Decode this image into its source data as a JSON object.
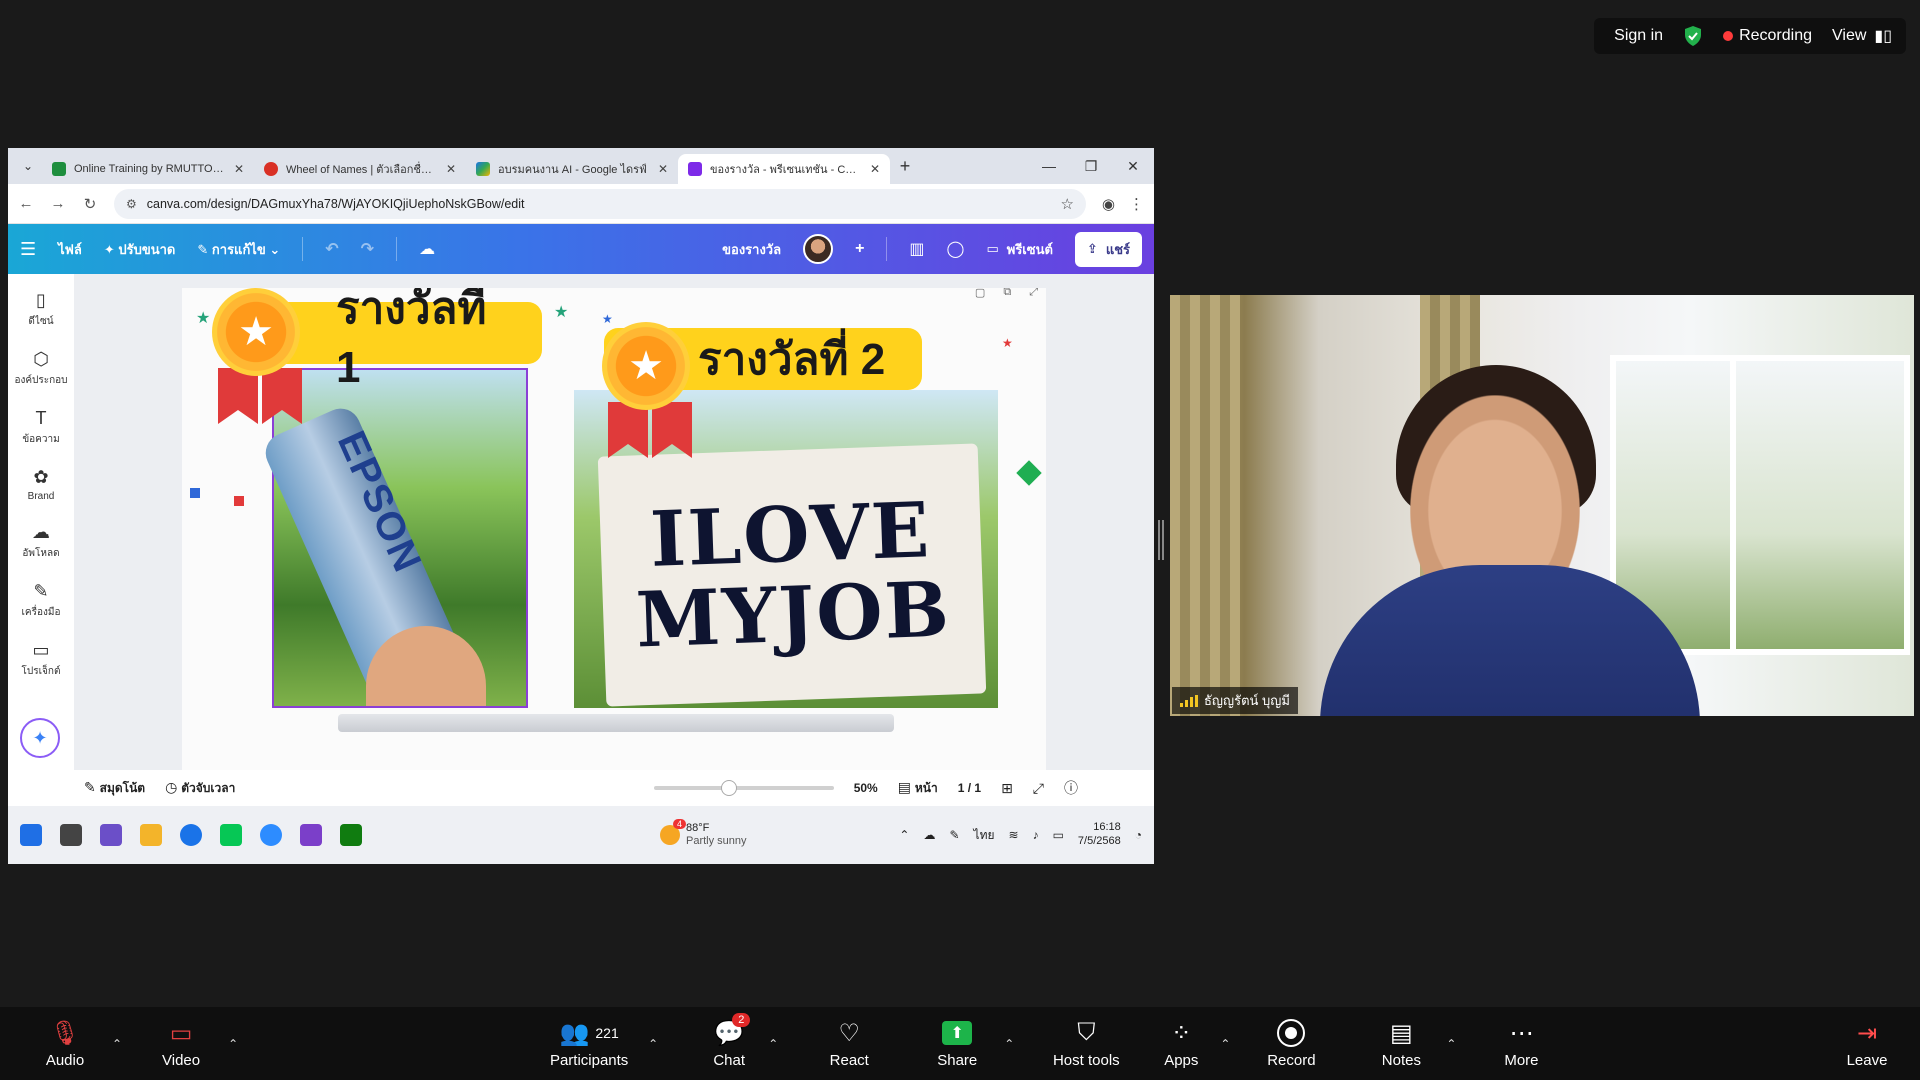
{
  "zoom_top": {
    "sign_in": "Sign in",
    "recording": "Recording",
    "view": "View"
  },
  "browser": {
    "tabs": [
      {
        "title": "Online Training by RMUTTO Lib",
        "fav_color": "#1e8e3e"
      },
      {
        "title": "Wheel of Names | ตัวเลือกชื่อแบบ",
        "fav_color": "#d93025"
      },
      {
        "title": "อบรมคนงาน AI - Google ไดรฟ์",
        "fav_color": "#f4b400"
      },
      {
        "title": "ของรางวัล - พรีเซนเทชัน - Canva",
        "fav_color": "#7d2ae8"
      }
    ],
    "url": "canva.com/design/DAGmuxYha78/WjAYOKIQjiUephoNskGBow/edit"
  },
  "canva": {
    "toolbar": {
      "file": "ไฟล์",
      "resize": "ปรับขนาด",
      "edit": "การแก้ไข",
      "doc_title": "ของรางวัล",
      "present": "พรีเซนต์",
      "share": "แชร์"
    },
    "sidebar": [
      {
        "label": "ดีไซน์",
        "icon": "▯"
      },
      {
        "label": "องค์ประกอบ",
        "icon": "⬡"
      },
      {
        "label": "ข้อความ",
        "icon": "T"
      },
      {
        "label": "Brand",
        "icon": "✿"
      },
      {
        "label": "อัพโหลด",
        "icon": "☁"
      },
      {
        "label": "เครื่องมือ",
        "icon": "✎"
      },
      {
        "label": "โปรเจ็กต์",
        "icon": "▭"
      }
    ],
    "slide": {
      "prize1": "รางวัลที่ 1",
      "prize2": "รางวัลที่ 2",
      "bottle_text": "EPSON",
      "sign_line1": "ILOVE",
      "sign_line2": "MYJOB"
    },
    "footer": {
      "notes": "สมุดโน้ต",
      "timer": "ตัวจับเวลา",
      "zoom": "50%",
      "page_label": "หน้า",
      "page_count": "1 / 1",
      "zoom_fraction": 0.42
    }
  },
  "taskbar": {
    "weather_temp": "88°F",
    "weather_desc": "Partly sunny",
    "weather_badge": "4",
    "lang": "ไทย",
    "time": "16:18",
    "date": "7/5/2568",
    "apps": [
      "#1f6fe5",
      "#444444",
      "#6b4fc8",
      "#f3b42a",
      "#1a73e8",
      "#06c755",
      "#2d8cff",
      "#7b3fc9",
      "#107c10"
    ]
  },
  "video": {
    "participant_name": "ธัญญรัตน์ บุญมี"
  },
  "zoom_bar": {
    "audio": "Audio",
    "video": "Video",
    "participants": "Participants",
    "participants_count": "221",
    "chat": "Chat",
    "chat_badge": "2",
    "react": "React",
    "share": "Share",
    "host_tools": "Host tools",
    "apps": "Apps",
    "record": "Record",
    "notes": "Notes",
    "more": "More",
    "leave": "Leave"
  }
}
